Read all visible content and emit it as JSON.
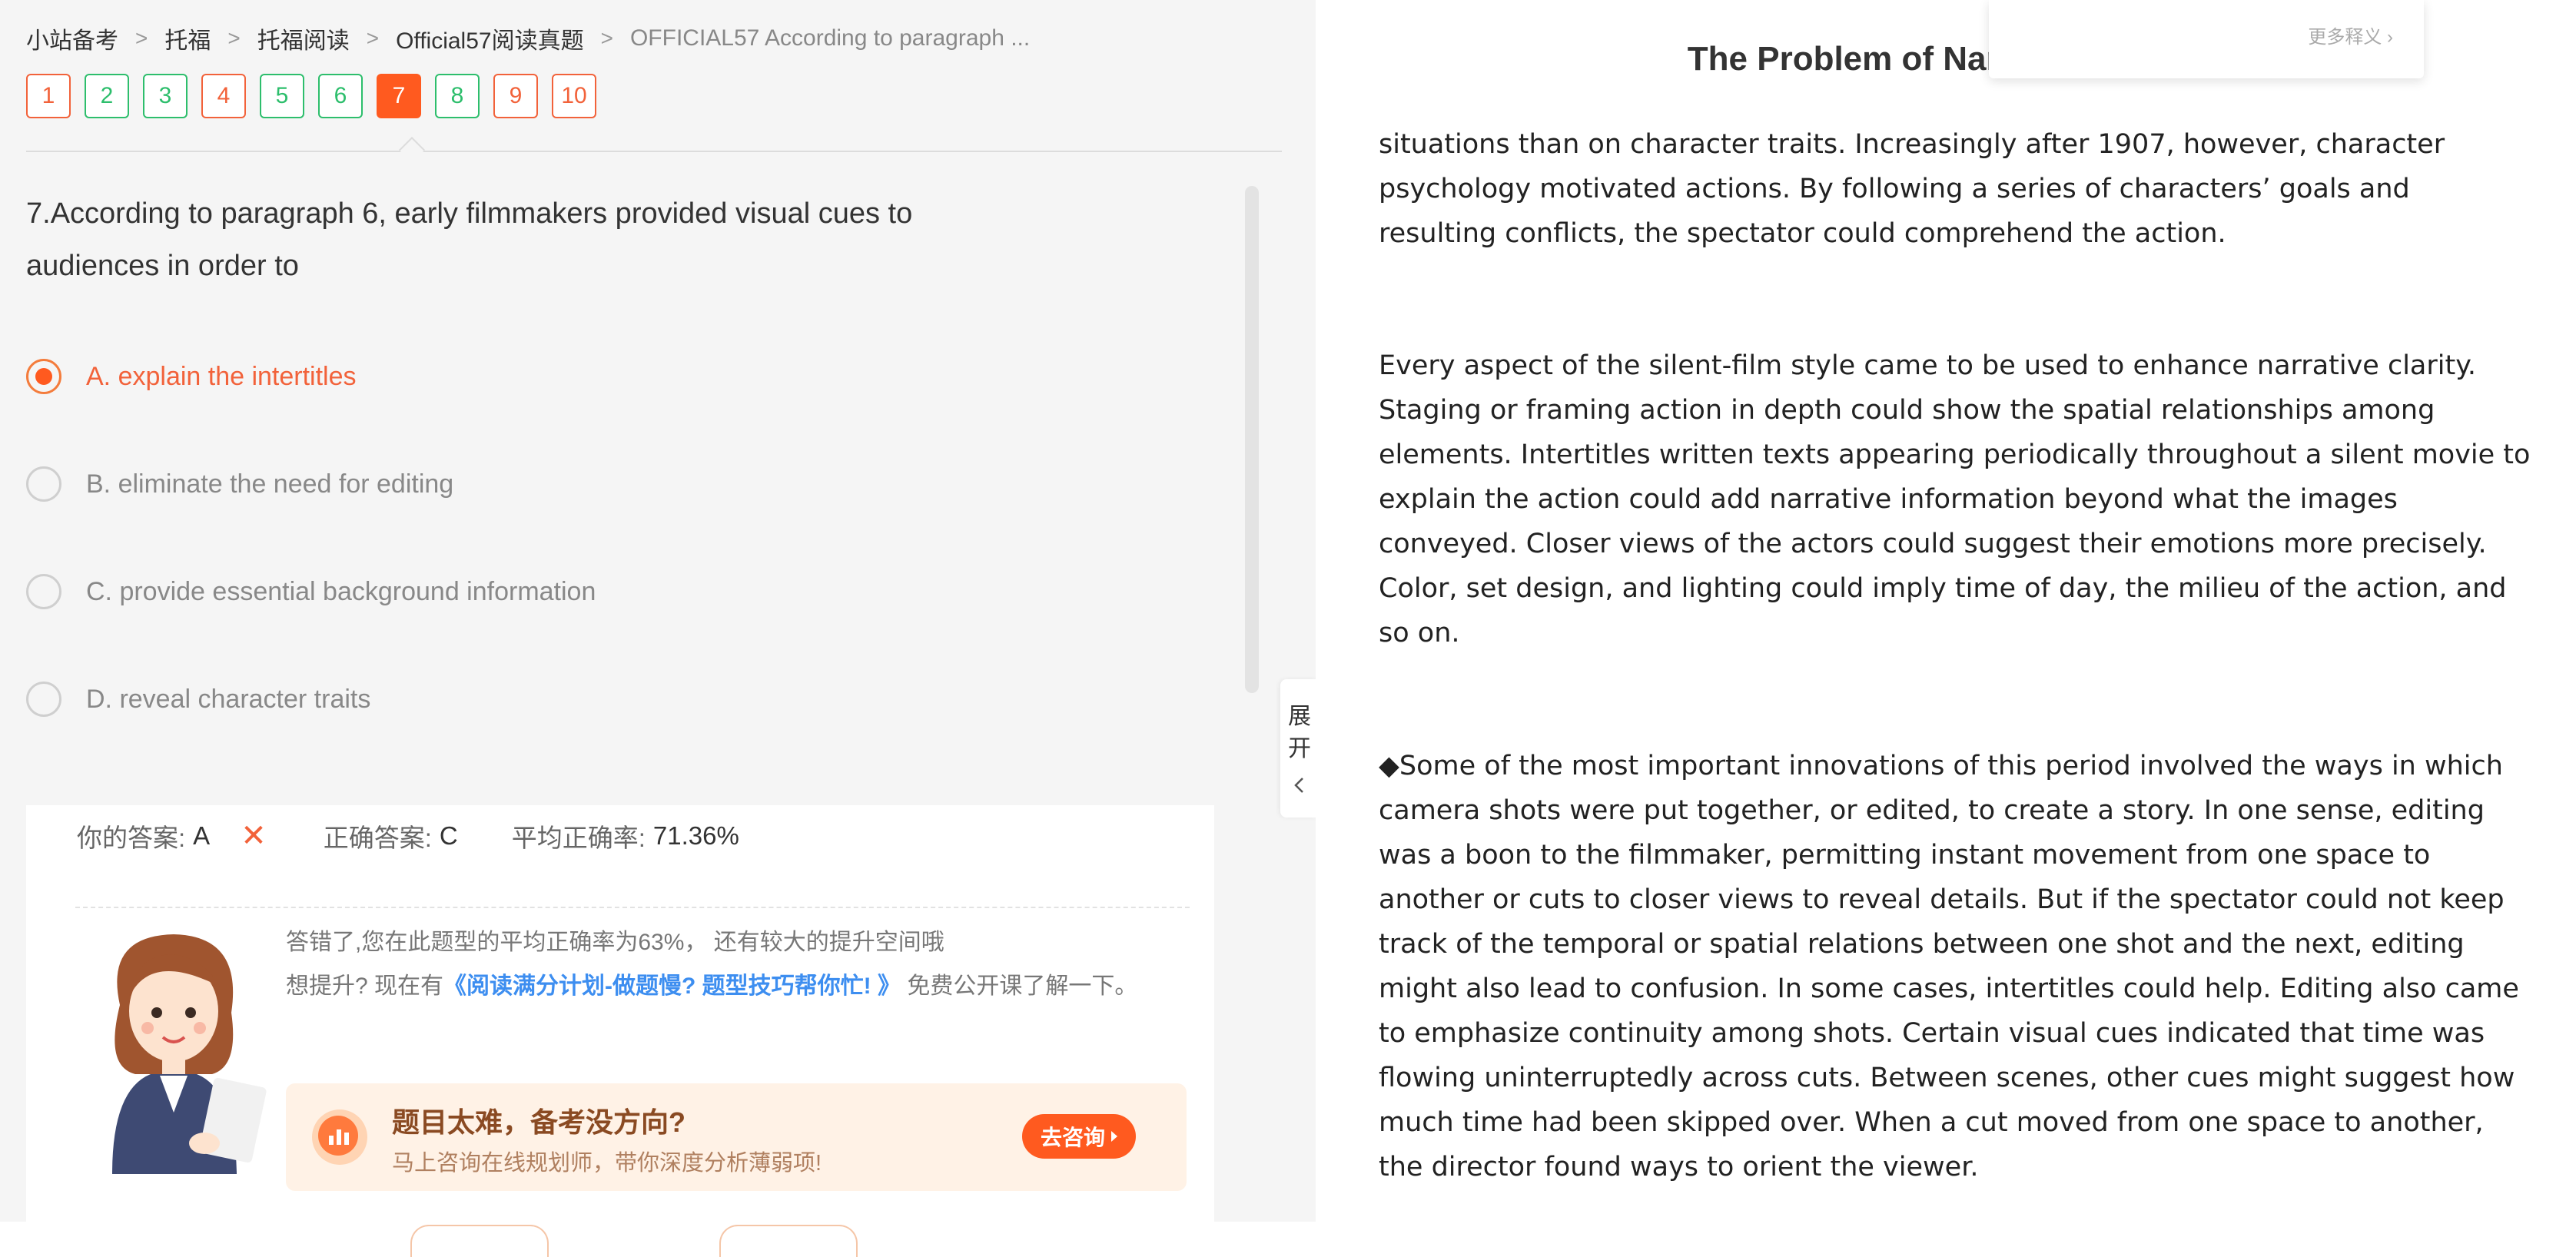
{
  "breadcrumb": {
    "items": [
      "小站备考",
      "托福",
      "托福阅读",
      "Official57阅读真题",
      "OFFICIAL57 According to paragraph ..."
    ]
  },
  "question_nav": {
    "numbers": [
      "1",
      "2",
      "3",
      "4",
      "5",
      "6",
      "7",
      "8",
      "9",
      "10"
    ],
    "states": [
      "wrong",
      "correct",
      "correct",
      "wrong",
      "correct",
      "correct",
      "active",
      "correct",
      "wrong",
      "wrong"
    ]
  },
  "question": {
    "text": "7.According to paragraph 6, early filmmakers provided visual cues to audiences in order to",
    "options": [
      {
        "label": "A. explain the intertitles",
        "selected": true
      },
      {
        "label": "B. eliminate the need for editing",
        "selected": false
      },
      {
        "label": "C. provide essential background information",
        "selected": false
      },
      {
        "label": "D. reveal character traits",
        "selected": false
      }
    ]
  },
  "result": {
    "your_answer_label": "你的答案:",
    "your_answer": "A",
    "correct_answer_label": "正确答案:",
    "correct_answer": "C",
    "avg_rate_label": "平均正确率:",
    "avg_rate": "71.36%",
    "tip_line1": "答错了,您在此题型的平均正确率为63%， 还有较大的提升空间哦",
    "tip_line2_prefix": "想提升? 现在有",
    "tip_link": "《阅读满分计划-做题慢? 题型技巧帮你忙! 》",
    "tip_line2_suffix": " 免费公开课了解一下。",
    "consult_title": "题目太难，备考没方向?",
    "consult_sub": "马上咨询在线规划师，带你深度分析薄弱项!",
    "consult_button": "去咨询"
  },
  "expand_tab": {
    "label": [
      "展",
      "开"
    ]
  },
  "popup": {
    "more": "更多释义"
  },
  "passage": {
    "title": "The Problem of Narrative Clarity",
    "paragraphs": [
      "situations than on character traits. Increasingly after 1907, however, character psychology motivated actions. By following a series of characters’ goals and resulting conflicts, the spectator could comprehend the action.",
      "Every aspect of the silent-film style came to be used to enhance narrative clarity. Staging or framing action in depth could show the spatial relationships among elements. Intertitles written texts appearing periodically throughout a silent movie to explain the action could add narrative information beyond what the images conveyed. Closer views of the actors could suggest their emotions more precisely. Color, set design, and lighting could imply time of day, the milieu of the action, and so on.",
      "◆Some of the most important innovations of this period involved the ways in which camera shots were put together, or edited, to create a story. In one sense, editing was a boon to the filmmaker, permitting instant movement from one space to another or cuts to closer views to reveal details. But if the spectator could not keep track of the temporal or spatial relations between one shot and the next, editing might also lead to confusion. In some cases, intertitles could help. Editing also came to emphasize continuity among shots. Certain visual cues indicated that time was flowing uninterruptedly across cuts. Between scenes, other cues might suggest how much time had been skipped over. When a cut moved from one space to another, the director found ways to orient the viewer."
    ]
  },
  "colors": {
    "accent": "#ff5a1f",
    "correct": "#2dbe6c",
    "wrong": "#f2623a",
    "link": "#3d8ef0"
  }
}
